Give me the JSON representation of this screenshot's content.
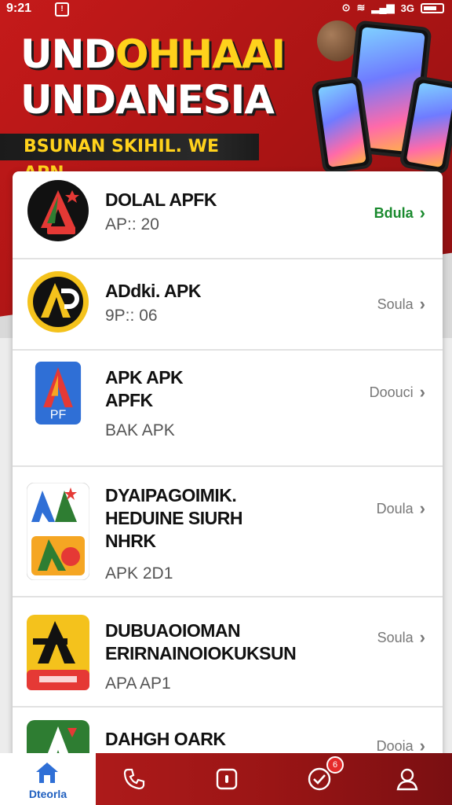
{
  "status": {
    "time": "9:21",
    "network": "3G"
  },
  "banner": {
    "headline_line1_a": "UND",
    "headline_line1_b": "OHHAAI",
    "headline_line2": "UNDANESIA",
    "tagline": "BSUNAN SKIHIL. WE APN"
  },
  "apps": [
    {
      "title": "DOLAL APFK",
      "subtitle": "AP:: 20",
      "action": "Bdula",
      "action_style": "green"
    },
    {
      "title": "ADdki. APK",
      "subtitle": "9P:: 06",
      "action": "Soula"
    },
    {
      "title_lines": [
        "APK APK",
        "APFK"
      ],
      "subtitle": "BAK APK",
      "action": "Doouci",
      "icon_text": "PF"
    },
    {
      "title_lines": [
        "DYAIPAGOIMIK.",
        "HEDUINE SIURH",
        "NHRK"
      ],
      "subtitle": "APK 2D1",
      "action": "Doula"
    },
    {
      "title_lines": [
        "DUBUAOIOMAN",
        "ERIRNAINOIOKUKSUN"
      ],
      "subtitle": "APA AP1",
      "action": "Soula"
    },
    {
      "title": "DAHGH OARK",
      "action": "Dooia"
    }
  ],
  "nav": {
    "home_label": "Dteorla",
    "badge_count": "6"
  }
}
